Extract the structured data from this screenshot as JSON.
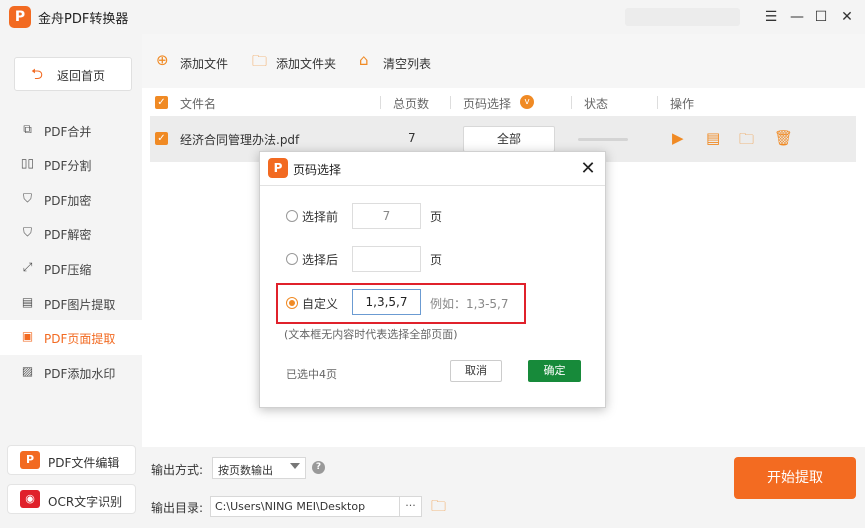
{
  "app": {
    "title": "金舟PDF转换器",
    "logo_letter": "P"
  },
  "window_controls": {
    "menu": "☰",
    "minimize": "—",
    "maximize": "☐",
    "close": "✕"
  },
  "sidebar": {
    "home_label": "返回首页",
    "items": [
      {
        "label": "PDF合并",
        "icon": "merge-icon"
      },
      {
        "label": "PDF分割",
        "icon": "split-icon"
      },
      {
        "label": "PDF加密",
        "icon": "lock-shield-icon"
      },
      {
        "label": "PDF解密",
        "icon": "unlock-shield-icon"
      },
      {
        "label": "PDF压缩",
        "icon": "compress-icon"
      },
      {
        "label": "PDF图片提取",
        "icon": "image-extract-icon"
      },
      {
        "label": "PDF页面提取",
        "icon": "page-extract-icon",
        "active": true
      },
      {
        "label": "PDF添加水印",
        "icon": "watermark-icon"
      }
    ],
    "tools": [
      {
        "label": "PDF文件编辑",
        "icon": "pdf-edit-icon",
        "color": "#f26a21"
      },
      {
        "label": "OCR文字识别",
        "icon": "ocr-eye-icon",
        "color": "#e0212b"
      }
    ]
  },
  "toolbar": {
    "add_file": "添加文件",
    "add_folder": "添加文件夹",
    "clear_list": "清空列表"
  },
  "table": {
    "headers": {
      "name": "文件名",
      "pages": "总页数",
      "range": "页码选择",
      "status": "状态",
      "actions": "操作"
    },
    "rows": [
      {
        "name": "经济合同管理办法.pdf",
        "pages": "7",
        "range": "全部"
      }
    ]
  },
  "bottom": {
    "output_mode_label": "输出方式:",
    "output_mode_value": "按页数输出",
    "output_dir_label": "输出目录:",
    "output_dir_value": "C:\\Users\\NING MEI\\Desktop",
    "browse_label": "···",
    "start_label": "开始提取"
  },
  "dialog": {
    "title": "页码选择",
    "options": {
      "first_label": "选择前",
      "first_value": "7",
      "last_label": "选择后",
      "last_value": "",
      "custom_label": "自定义",
      "custom_value": "1,3,5,7",
      "unit": "页",
      "example": "例如：1,3-5,7"
    },
    "hint": "(文本框无内容时代表选择全部页面)",
    "selected_count": "已选中4页",
    "cancel": "取消",
    "ok": "确定"
  },
  "colors": {
    "accent": "#f26a21",
    "ok": "#178a3a",
    "highlight": "#e0212b"
  }
}
